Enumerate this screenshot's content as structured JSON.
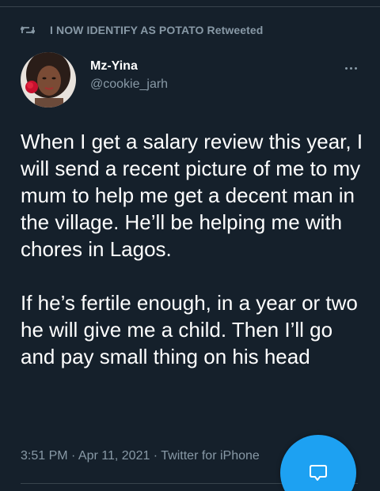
{
  "retweet": {
    "label": "I NOW IDENTIFY AS POTATO Retweeted",
    "icon": "retweet-icon"
  },
  "author": {
    "name": "Mz-Yina",
    "handle": "@cookie_jarh"
  },
  "tweet": {
    "paragraphs": [
      "When I get a salary review this year, I will send a recent picture of me to my mum to help me get a decent man in the village. He’ll be helping me with chores in Lagos.",
      "If he’s fertile enough, in a year or two he will give me a child. Then I’ll go and pay small thing on his head"
    ],
    "timestamp": "3:51 PM · Apr 11, 2021 · Twitter for iPhone"
  },
  "icons": {
    "more": "more-horizontal-icon",
    "compose": "new-message-icon"
  },
  "colors": {
    "background": "#15202b",
    "secondary_text": "#8899a6",
    "accent": "#1da1f2"
  }
}
